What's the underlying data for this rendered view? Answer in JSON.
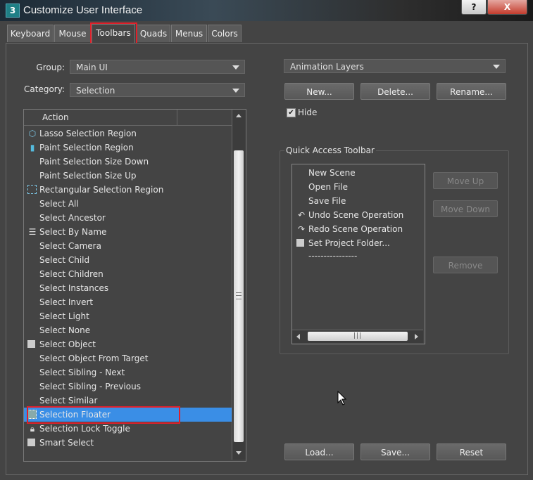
{
  "window": {
    "title": "Customize User Interface",
    "app_icon_text": "3",
    "help_label": "?",
    "close_label": "X"
  },
  "tabs": [
    {
      "label": "Keyboard"
    },
    {
      "label": "Mouse"
    },
    {
      "label": "Toolbars",
      "active": true
    },
    {
      "label": "Quads"
    },
    {
      "label": "Menus"
    },
    {
      "label": "Colors"
    }
  ],
  "left": {
    "group_label": "Group:",
    "group_value": "Main UI",
    "category_label": "Category:",
    "category_value": "Selection",
    "list_header": "Action",
    "actions": [
      {
        "label": "Lasso Selection Region",
        "icon": "lasso-icon"
      },
      {
        "label": "Paint Selection Region",
        "icon": "paint-brush-icon"
      },
      {
        "label": "Paint Selection Size Down",
        "icon": ""
      },
      {
        "label": "Paint Selection Size Up",
        "icon": ""
      },
      {
        "label": "Rectangular Selection Region",
        "icon": "rectangle-select-icon"
      },
      {
        "label": "Select All",
        "icon": ""
      },
      {
        "label": "Select Ancestor",
        "icon": ""
      },
      {
        "label": "Select By Name",
        "icon": "select-by-name-icon"
      },
      {
        "label": "Select Camera",
        "icon": ""
      },
      {
        "label": "Select Child",
        "icon": ""
      },
      {
        "label": "Select Children",
        "icon": ""
      },
      {
        "label": "Select Instances",
        "icon": ""
      },
      {
        "label": "Select Invert",
        "icon": ""
      },
      {
        "label": "Select Light",
        "icon": ""
      },
      {
        "label": "Select None",
        "icon": ""
      },
      {
        "label": "Select Object",
        "icon": "select-object-icon"
      },
      {
        "label": "Select Object From Target",
        "icon": ""
      },
      {
        "label": "Select Sibling - Next",
        "icon": ""
      },
      {
        "label": "Select Sibling - Previous",
        "icon": ""
      },
      {
        "label": "Select Similar",
        "icon": ""
      },
      {
        "label": "Selection Floater",
        "icon": "selection-floater-icon",
        "selected": true
      },
      {
        "label": "Selection Lock Toggle",
        "icon": "lock-icon"
      },
      {
        "label": "Smart Select",
        "icon": "smart-select-icon"
      }
    ]
  },
  "right": {
    "toolbar_value": "Animation Layers",
    "new_label": "New...",
    "delete_label": "Delete...",
    "rename_label": "Rename...",
    "hide_label": "Hide",
    "hide_checked": true,
    "quick_access_title": "Quick Access Toolbar",
    "quick_items": [
      {
        "label": "New Scene",
        "icon": ""
      },
      {
        "label": "Open File",
        "icon": ""
      },
      {
        "label": "Save File",
        "icon": ""
      },
      {
        "label": "Undo Scene Operation",
        "icon": "undo-icon"
      },
      {
        "label": "Redo Scene Operation",
        "icon": "redo-icon"
      },
      {
        "label": "Set Project Folder...",
        "icon": "project-folder-icon"
      },
      {
        "label": "----------------",
        "icon": ""
      }
    ],
    "move_up_label": "Move Up",
    "move_down_label": "Move Down",
    "remove_label": "Remove",
    "load_label": "Load...",
    "save_label": "Save...",
    "reset_label": "Reset"
  }
}
